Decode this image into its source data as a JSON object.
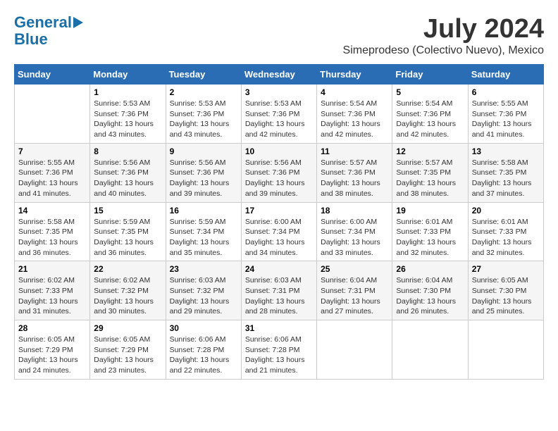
{
  "logo": {
    "line1": "General",
    "line2": "Blue"
  },
  "title": "July 2024",
  "subtitle": "Simeprodeso (Colectivo Nuevo), Mexico",
  "days_of_week": [
    "Sunday",
    "Monday",
    "Tuesday",
    "Wednesday",
    "Thursday",
    "Friday",
    "Saturday"
  ],
  "weeks": [
    [
      {
        "day": "",
        "info": ""
      },
      {
        "day": "1",
        "info": "Sunrise: 5:53 AM\nSunset: 7:36 PM\nDaylight: 13 hours\nand 43 minutes."
      },
      {
        "day": "2",
        "info": "Sunrise: 5:53 AM\nSunset: 7:36 PM\nDaylight: 13 hours\nand 43 minutes."
      },
      {
        "day": "3",
        "info": "Sunrise: 5:53 AM\nSunset: 7:36 PM\nDaylight: 13 hours\nand 42 minutes."
      },
      {
        "day": "4",
        "info": "Sunrise: 5:54 AM\nSunset: 7:36 PM\nDaylight: 13 hours\nand 42 minutes."
      },
      {
        "day": "5",
        "info": "Sunrise: 5:54 AM\nSunset: 7:36 PM\nDaylight: 13 hours\nand 42 minutes."
      },
      {
        "day": "6",
        "info": "Sunrise: 5:55 AM\nSunset: 7:36 PM\nDaylight: 13 hours\nand 41 minutes."
      }
    ],
    [
      {
        "day": "7",
        "info": "Sunrise: 5:55 AM\nSunset: 7:36 PM\nDaylight: 13 hours\nand 41 minutes."
      },
      {
        "day": "8",
        "info": "Sunrise: 5:56 AM\nSunset: 7:36 PM\nDaylight: 13 hours\nand 40 minutes."
      },
      {
        "day": "9",
        "info": "Sunrise: 5:56 AM\nSunset: 7:36 PM\nDaylight: 13 hours\nand 39 minutes."
      },
      {
        "day": "10",
        "info": "Sunrise: 5:56 AM\nSunset: 7:36 PM\nDaylight: 13 hours\nand 39 minutes."
      },
      {
        "day": "11",
        "info": "Sunrise: 5:57 AM\nSunset: 7:36 PM\nDaylight: 13 hours\nand 38 minutes."
      },
      {
        "day": "12",
        "info": "Sunrise: 5:57 AM\nSunset: 7:35 PM\nDaylight: 13 hours\nand 38 minutes."
      },
      {
        "day": "13",
        "info": "Sunrise: 5:58 AM\nSunset: 7:35 PM\nDaylight: 13 hours\nand 37 minutes."
      }
    ],
    [
      {
        "day": "14",
        "info": "Sunrise: 5:58 AM\nSunset: 7:35 PM\nDaylight: 13 hours\nand 36 minutes."
      },
      {
        "day": "15",
        "info": "Sunrise: 5:59 AM\nSunset: 7:35 PM\nDaylight: 13 hours\nand 36 minutes."
      },
      {
        "day": "16",
        "info": "Sunrise: 5:59 AM\nSunset: 7:34 PM\nDaylight: 13 hours\nand 35 minutes."
      },
      {
        "day": "17",
        "info": "Sunrise: 6:00 AM\nSunset: 7:34 PM\nDaylight: 13 hours\nand 34 minutes."
      },
      {
        "day": "18",
        "info": "Sunrise: 6:00 AM\nSunset: 7:34 PM\nDaylight: 13 hours\nand 33 minutes."
      },
      {
        "day": "19",
        "info": "Sunrise: 6:01 AM\nSunset: 7:33 PM\nDaylight: 13 hours\nand 32 minutes."
      },
      {
        "day": "20",
        "info": "Sunrise: 6:01 AM\nSunset: 7:33 PM\nDaylight: 13 hours\nand 32 minutes."
      }
    ],
    [
      {
        "day": "21",
        "info": "Sunrise: 6:02 AM\nSunset: 7:33 PM\nDaylight: 13 hours\nand 31 minutes."
      },
      {
        "day": "22",
        "info": "Sunrise: 6:02 AM\nSunset: 7:32 PM\nDaylight: 13 hours\nand 30 minutes."
      },
      {
        "day": "23",
        "info": "Sunrise: 6:03 AM\nSunset: 7:32 PM\nDaylight: 13 hours\nand 29 minutes."
      },
      {
        "day": "24",
        "info": "Sunrise: 6:03 AM\nSunset: 7:31 PM\nDaylight: 13 hours\nand 28 minutes."
      },
      {
        "day": "25",
        "info": "Sunrise: 6:04 AM\nSunset: 7:31 PM\nDaylight: 13 hours\nand 27 minutes."
      },
      {
        "day": "26",
        "info": "Sunrise: 6:04 AM\nSunset: 7:30 PM\nDaylight: 13 hours\nand 26 minutes."
      },
      {
        "day": "27",
        "info": "Sunrise: 6:05 AM\nSunset: 7:30 PM\nDaylight: 13 hours\nand 25 minutes."
      }
    ],
    [
      {
        "day": "28",
        "info": "Sunrise: 6:05 AM\nSunset: 7:29 PM\nDaylight: 13 hours\nand 24 minutes."
      },
      {
        "day": "29",
        "info": "Sunrise: 6:05 AM\nSunset: 7:29 PM\nDaylight: 13 hours\nand 23 minutes."
      },
      {
        "day": "30",
        "info": "Sunrise: 6:06 AM\nSunset: 7:28 PM\nDaylight: 13 hours\nand 22 minutes."
      },
      {
        "day": "31",
        "info": "Sunrise: 6:06 AM\nSunset: 7:28 PM\nDaylight: 13 hours\nand 21 minutes."
      },
      {
        "day": "",
        "info": ""
      },
      {
        "day": "",
        "info": ""
      },
      {
        "day": "",
        "info": ""
      }
    ]
  ]
}
